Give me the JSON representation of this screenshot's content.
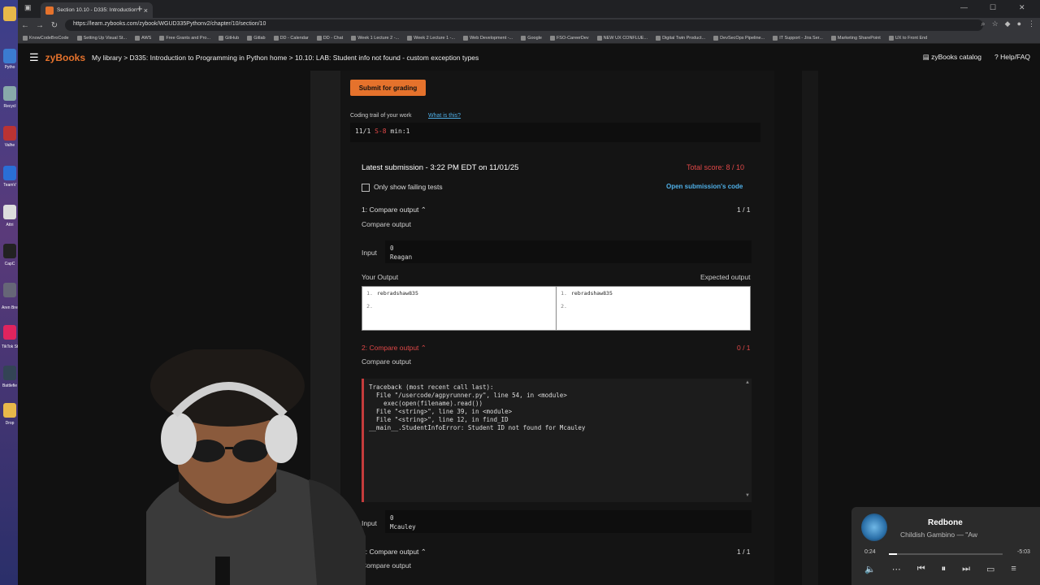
{
  "browser": {
    "tab_title": "Section 10.10 - D335: Introduction",
    "url": "https://learn.zybooks.com/zybook/WGUD335Pythonv2/chapter/10/section/10",
    "bookmarks": [
      "KnowCodeBroCode",
      "Setting Up Visual St...",
      "AWS",
      "Free Grants and Pro...",
      "GitHub",
      "Gitlab",
      "DD - Calendar",
      "DD - Chat",
      "Week 1 Lecture 2 -...",
      "Week 2 Lecture 1 -...",
      "Web Development -...",
      "Google",
      "FSO-CareerDev",
      "NEW UX CONFLUE...",
      "Digital Twin Product...",
      "DevSecOps Pipeline...",
      "IT Support - Jira Ser...",
      "Marketing SharePoint",
      "UX to Front End"
    ]
  },
  "taskbar": {
    "labels": [
      "Pytho",
      "Recycl",
      "Valhe",
      "TeamV",
      "Attri",
      "CapC",
      "Aren Break",
      "TikTok Studi",
      "Battlefie",
      "Drop"
    ]
  },
  "header": {
    "logo": "zyBooks",
    "breadcrumb": "My library  >  D335: Introduction to Programming in Python home  >  10.10: LAB: Student info not found - custom exception types",
    "catalog": "zyBooks catalog",
    "help": "Help/FAQ"
  },
  "lab": {
    "submit_label": "Submit for grading",
    "trail_label": "Coding trail of your work",
    "trail_link": "What is this?",
    "trail_date": "11/1",
    "trail_marks": "S-8",
    "trail_min": "min:1",
    "latest_submission": "Latest submission - 3:22 PM EDT on 11/01/25",
    "total_score": "Total score: 8 / 10",
    "failing_label": "Only show failing tests",
    "open_code": "Open submission's code"
  },
  "tests": [
    {
      "title": "1: Compare output",
      "score": "1 / 1",
      "sub": "Compare output",
      "input_label": "Input",
      "input": "0\nReagan",
      "your_output_label": "Your Output",
      "expected_label": "Expected output",
      "your_output": [
        "rebradshaw835",
        ""
      ],
      "expected_output": [
        "rebradshaw835",
        ""
      ]
    },
    {
      "title": "2: Compare output",
      "score": "0 / 1",
      "sub": "Compare output",
      "traceback": "Traceback (most recent call last):\n  File \"/usercode/agpyrunner.py\", line 54, in <module>\n    exec(open(filename).read())\n  File \"<string>\", line 39, in <module>\n  File \"<string>\", line 12, in find_ID\n__main__.StudentInfoError: Student ID not found for Mcauley",
      "input_label": "Input",
      "input": "0\nMcauley"
    },
    {
      "title": "3: Compare output",
      "score": "1 / 1",
      "sub": "Compare output"
    }
  ],
  "media": {
    "song": "Redbone",
    "artist": "Childish Gambino — \"Aw",
    "time_now": "0:24",
    "time_left": "-5:03",
    "progress": 0.07
  },
  "colors": {
    "accent": "#e5722c",
    "error": "#e04848",
    "link": "#4fb0e8"
  }
}
